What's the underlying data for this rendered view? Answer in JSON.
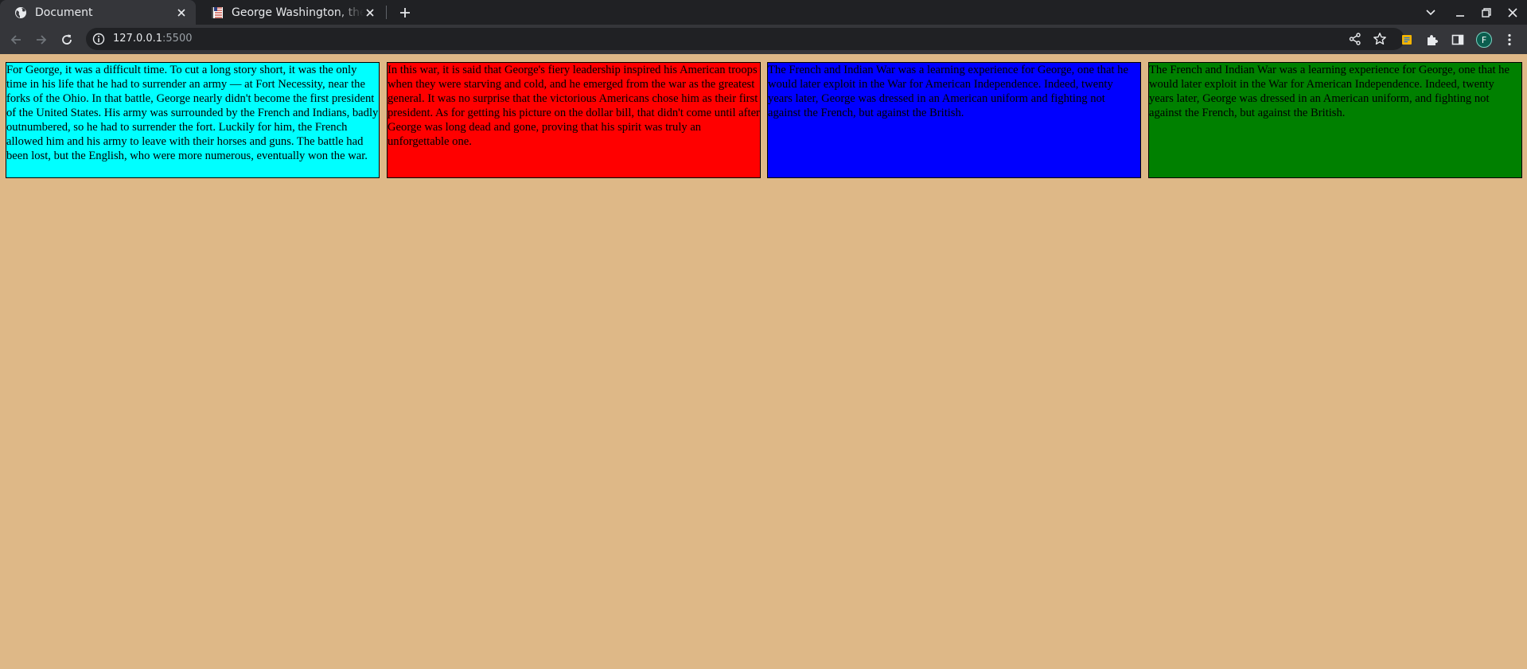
{
  "browser": {
    "tabs": [
      {
        "title": "Document",
        "active": true,
        "favicon": "globe-icon"
      },
      {
        "title": "George Washington, the u",
        "active": false,
        "favicon": "flag-icon"
      }
    ],
    "url": {
      "host": "127.0.0.1",
      "port": ":5500"
    },
    "profile_initial": "F"
  },
  "page": {
    "background": "#deb887",
    "boxes": [
      {
        "color": "#00ffff",
        "text": "For George, it was a difficult time. To cut a long story short, it was the only time in his life that he had to surrender an army — at Fort Necessity, near the forks of the Ohio. In that battle, George nearly didn't become the first president of the United States. His army was surrounded by the French and Indians, badly outnumbered, so he had to surrender the fort. Luckily for him, the French allowed him and his army to leave with their horses and guns. The battle had been lost, but the English, who were more numerous, eventually won the war."
      },
      {
        "color": "#ff0000",
        "text": "In this war, it is said that George's fiery leadership inspired his American troops when they were starving and cold, and he emerged from the war as the greatest general. It was no surprise that the victorious Americans chose him as their first president. As for getting his picture on the dollar bill, that didn't come until after George was long dead and gone, proving that his spirit was truly an unforgettable one."
      },
      {
        "color": "#0000ff",
        "text": "The French and Indian War was a learning experience for George, one that he would later exploit in the War for American Independence. Indeed, twenty years later, George was dressed in an American uniform and fighting not against the French, but against the British."
      },
      {
        "color": "#008000",
        "text": "The French and Indian War was a learning experience for George, one that he would later exploit in the War for American Independence. Indeed, twenty years later, George was dressed in an American uniform, and fighting not against the French, but against the British."
      }
    ]
  }
}
